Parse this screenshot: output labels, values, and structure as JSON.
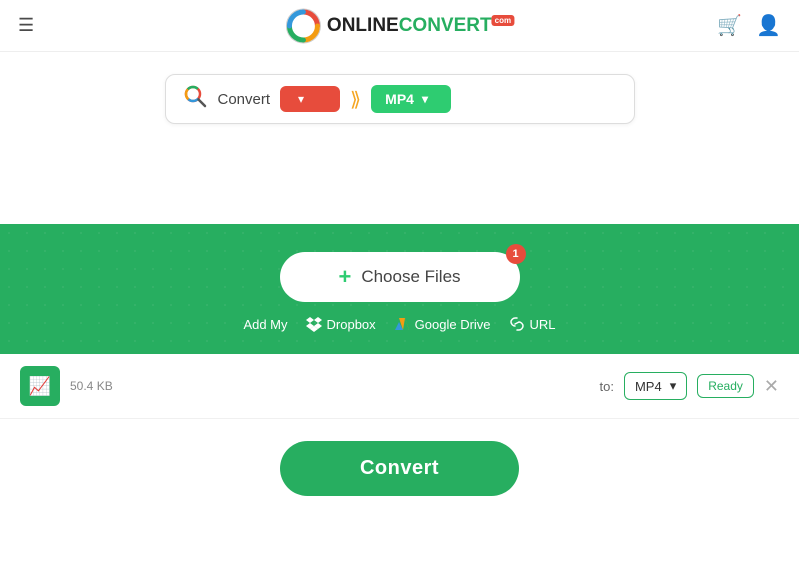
{
  "header": {
    "hamburger_label": "☰",
    "logo_online": "ONLINE",
    "logo_convert": "CONVERT",
    "logo_badge": "com",
    "cart_icon": "🛒",
    "user_icon": "👤"
  },
  "search_bar": {
    "search_icon": "🔍",
    "convert_label": "Convert",
    "from_placeholder": "",
    "arrow": "⟫",
    "to_format": "MP4",
    "from_chevron": "▾",
    "to_chevron": "▾"
  },
  "upload": {
    "choose_files_label": "Choose Files",
    "badge_count": "1",
    "add_my_label": "Add My",
    "dropbox_label": "Dropbox",
    "google_drive_label": "Google Drive",
    "url_label": "URL"
  },
  "file_row": {
    "file_icon": "📈",
    "file_size": "50.4 KB",
    "to_label": "to:",
    "format": "MP4",
    "format_chevron": "▾",
    "status": "Ready",
    "close_icon": "✕"
  },
  "convert_button": {
    "label": "Convert"
  }
}
